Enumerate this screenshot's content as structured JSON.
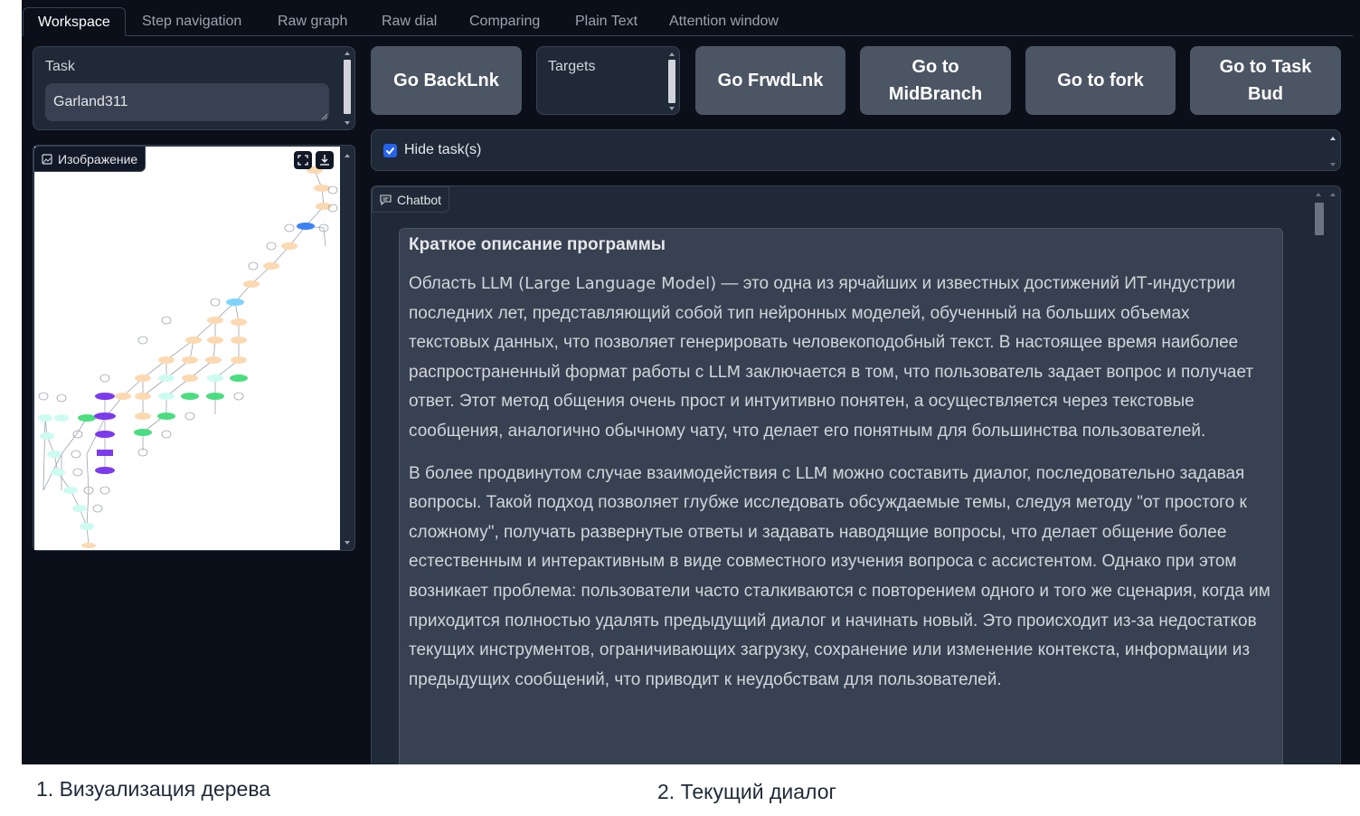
{
  "tabs": [
    "Workspace",
    "Step navigation",
    "Raw graph",
    "Raw dial",
    "Comparing",
    "Plain Text",
    "Attention window"
  ],
  "task": {
    "label": "Task",
    "value": "Garland311"
  },
  "image_panel": {
    "label": "Изображение"
  },
  "targets": {
    "label": "Targets"
  },
  "buttons": {
    "back": "Go BackLnk",
    "forward": "Go FrwdLnk",
    "midbranch_line1": "Go to",
    "midbranch_line2": "MidBranch",
    "fork": "Go to fork",
    "taskbud_line1": "Go to Task",
    "taskbud_line2": "Bud"
  },
  "hide_tasks": {
    "label": "Hide task(s)",
    "checked": true
  },
  "chatbot": {
    "label": "Chatbot",
    "heading": "Краткое описание программы",
    "p1_a": "Область ",
    "p1_b": "LLM (Large Language Model)",
    "p1_c": " — это одна из ярчайших и известных достижений ИТ-индустрии последних лет, представляющий собой тип нейронных моделей, обученный на больших объемах текстовых данных, что позволяет генерировать человекоподобный текст. В настоящее время наиболее распространенный формат работы с ",
    "p1_d": "LLM",
    "p1_e": " заключается в том, что пользователь задает вопрос и получает ответ. Этот метод общения очень прост и интуитивно понятен, а осуществляется через текстовые сообщения, аналогично обычному чату, что делает его понятным для большинства пользователей.",
    "p2_a": "В более продвинутом случае взаимодействия с ",
    "p2_b": "LLM",
    "p2_c": " можно составить диалог, последовательно задавая вопросы. Такой подход позволяет глубже исследовать обсуждаемые темы, следуя методу \"от простого к сложному\", получать развернутые ответы и задавать наводящие вопросы, что делает общение более естественным и интерактивным в виде совместного изучения вопроса с ассистентом. Однако при этом возникает проблема: пользователи часто сталкиваются с повторением одного и того же сценария, когда им приходится полностью удалять предыдущий диалог и начинать новый. Это происходит из-за недостатков текущих инструментов, ограничивающих загрузку, сохранение или изменение контекста, информации из предыдущих сообщений, что приводит к неудобствам для пользователей."
  },
  "captions": {
    "left": "1. Визуализация дерева",
    "right": "2. Текущий диалог"
  },
  "colors": {
    "background": "#0b0f19",
    "panel": "#1f2937",
    "button": "#4b5563",
    "checkbox": "#2563eb",
    "node_purple": "#7c3aed",
    "node_green": "#4ade80",
    "node_blue": "#3b82f6",
    "node_peach": "#fcd9b0"
  }
}
